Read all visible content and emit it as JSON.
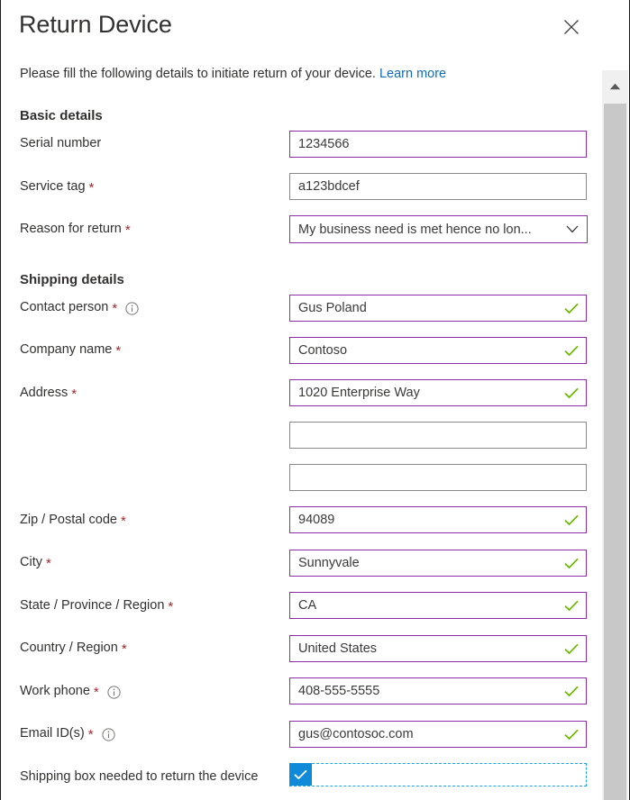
{
  "dialog": {
    "title": "Return Device",
    "close_label": "Close",
    "intro_text": "Please fill the following details to initiate return of your device.",
    "intro_link": "Learn more"
  },
  "sections": {
    "basic": "Basic details",
    "shipping": "Shipping details"
  },
  "fields": {
    "serial_number": {
      "label": "Serial number",
      "value": "1234566"
    },
    "service_tag": {
      "label": "Service tag",
      "value": "a123bdcef"
    },
    "reason_for_return": {
      "label": "Reason for return",
      "value": "My business need is met hence no lon..."
    },
    "contact_person": {
      "label": "Contact person",
      "value": "Gus Poland"
    },
    "company_name": {
      "label": "Company name",
      "value": "Contoso"
    },
    "address": {
      "label": "Address",
      "value": "1020 Enterprise Way"
    },
    "address_line2": {
      "label": "",
      "value": ""
    },
    "address_line3": {
      "label": "",
      "value": ""
    },
    "zip_postal_code": {
      "label": "Zip / Postal code",
      "value": "94089"
    },
    "city": {
      "label": "City",
      "value": "Sunnyvale"
    },
    "state_province_region": {
      "label": "State / Province / Region",
      "value": "CA"
    },
    "country_region": {
      "label": "Country / Region",
      "value": "United States"
    },
    "work_phone": {
      "label": "Work phone",
      "value": "408-555-5555"
    },
    "email_ids": {
      "label": "Email ID(s)",
      "value": "gus@contosoc.com"
    },
    "shipping_box": {
      "label": "Shipping box needed to return the device",
      "checked": true
    }
  },
  "markers": {
    "required": "*"
  },
  "colors": {
    "accent_border": "#8e2da8",
    "default_border": "#8a8886",
    "valid_check": "#6bb700",
    "link": "#0f6cbd",
    "required_asterisk": "#a4262c",
    "checkbox_fill": "#0f8ad8",
    "focus_outline": "#1aa3e8",
    "scrollbar_thumb": "#c8c8c8"
  }
}
